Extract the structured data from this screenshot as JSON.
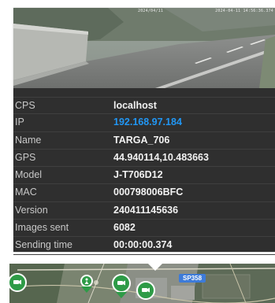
{
  "camera": {
    "overlay_left": "2024/04/11",
    "overlay_right": "2024-04-11 14:56:36.374"
  },
  "info": {
    "rows": [
      {
        "label": "CPS",
        "value": "localhost"
      },
      {
        "label": "IP",
        "value": "192.168.97.184"
      },
      {
        "label": "Name",
        "value": "TARGA_706"
      },
      {
        "label": "GPS",
        "value": "44.940114,10.483663"
      },
      {
        "label": "Model",
        "value": "J-T706D12"
      },
      {
        "label": "MAC",
        "value": "000798006BFC"
      },
      {
        "label": "Version",
        "value": "240411145636"
      },
      {
        "label": "Images sent",
        "value": "6082"
      },
      {
        "label": "Sending time",
        "value": "00:00:00.374"
      }
    ]
  },
  "map": {
    "road_label": "SP358",
    "marker_icon": "camera-icon",
    "marker_color": "#2e9b47",
    "road_badge_color": "#3d7bd9"
  }
}
